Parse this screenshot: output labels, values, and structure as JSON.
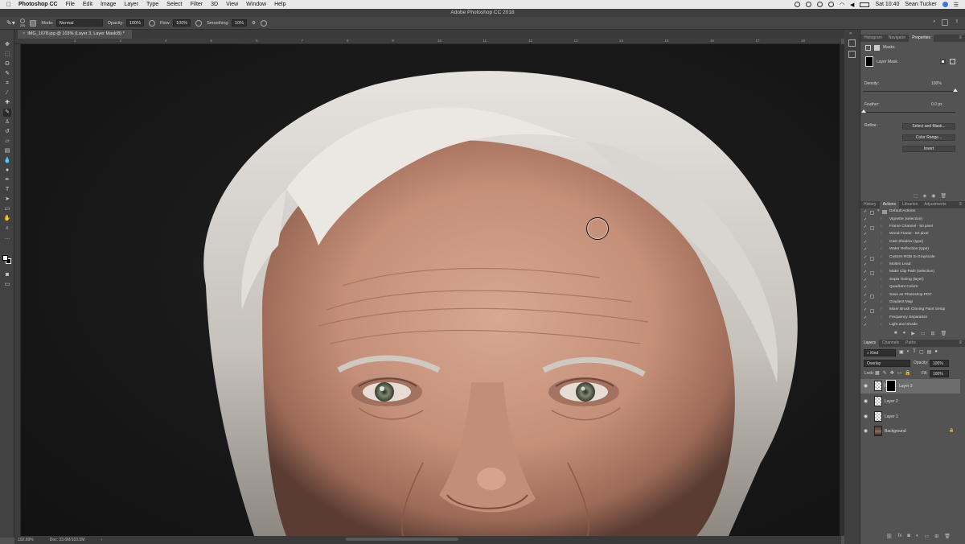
{
  "menubar": {
    "apple": "",
    "app": "Photoshop CC",
    "items": [
      "File",
      "Edit",
      "Image",
      "Layer",
      "Type",
      "Select",
      "Filter",
      "3D",
      "View",
      "Window",
      "Help"
    ],
    "clock": "Sat 10:40",
    "user": "Sean Tucker"
  },
  "titlebar": {
    "title": "Adobe Photoshop CC 2018"
  },
  "options": {
    "brush_size": "200",
    "mode_label": "Mode:",
    "mode_value": "Normal",
    "opacity_label": "Opacity:",
    "opacity_value": "100%",
    "flow_label": "Flow:",
    "flow_value": "100%",
    "smoothing_label": "Smoothing:",
    "smoothing_value": "10%"
  },
  "document": {
    "tab_title": "IMG_1678.jpg @ 103% (Layer 3, Layer Mask/8) *",
    "zoom": "102.69%",
    "doc_size": "Doc: 33.6M/103.5M"
  },
  "ruler": {
    "top_ticks": [
      "2",
      "3",
      "4",
      "5",
      "6",
      "7",
      "8",
      "9",
      "10",
      "11",
      "12",
      "13",
      "14",
      "15",
      "16",
      "17",
      "18",
      "19"
    ]
  },
  "properties": {
    "tabs": [
      "Histogram",
      "Navigator",
      "Properties"
    ],
    "active_tab": "Properties",
    "section": "Masks",
    "mask_label": "Layer Mask",
    "density_label": "Density:",
    "density_value": "100%",
    "density_level_pct": 100,
    "feather_label": "Feather:",
    "feather_value": "0.0 px",
    "feather_level_pct": 0,
    "refine_label": "Refine:",
    "buttons": [
      "Select and Mask...",
      "Color Range...",
      "Invert"
    ]
  },
  "actions": {
    "tabs": [
      "History",
      "Actions",
      "Libraries",
      "Adjustments"
    ],
    "active_tab": "Actions",
    "set_name": "Default Actions",
    "items": [
      {
        "label": "Vignette (selection)",
        "dialog": false
      },
      {
        "label": "Frame Channel - 50 pixel",
        "dialog": true
      },
      {
        "label": "Wood Frame - 50 pixel",
        "dialog": false
      },
      {
        "label": "Cast Shadow (type)",
        "dialog": false
      },
      {
        "label": "Water Reflection (type)",
        "dialog": false
      },
      {
        "label": "Custom RGB to Grayscale",
        "dialog": true
      },
      {
        "label": "Molten Lead",
        "dialog": false
      },
      {
        "label": "Make Clip Path (selection)",
        "dialog": true
      },
      {
        "label": "Sepia Toning (layer)",
        "dialog": false
      },
      {
        "label": "Quadrant Colors",
        "dialog": false
      },
      {
        "label": "Save as Photoshop PDF",
        "dialog": true
      },
      {
        "label": "Gradient Map",
        "dialog": false
      },
      {
        "label": "Mixer Brush Cloning Paint Setup",
        "dialog": true
      },
      {
        "label": "Frequency Separation",
        "dialog": false
      },
      {
        "label": "Light and Shade",
        "dialog": false
      }
    ]
  },
  "layers": {
    "tabs": [
      "Layers",
      "Channels",
      "Paths"
    ],
    "active_tab": "Layers",
    "filter_kind": "Kind",
    "blend_mode": "Overlay",
    "opacity_label": "Opacity:",
    "opacity_value": "100%",
    "lock_label": "Lock:",
    "fill_label": "Fill:",
    "fill_value": "100%",
    "items": [
      "Layer 3",
      "Layer 2",
      "Layer 1",
      "Background"
    ]
  }
}
